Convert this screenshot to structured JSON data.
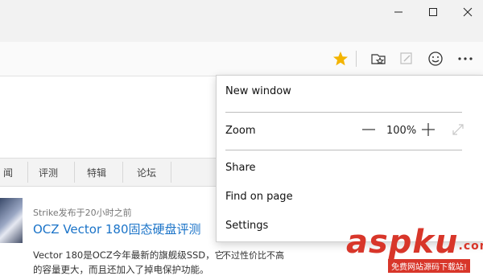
{
  "colors": {
    "accent": "#1a73c8",
    "favorite_star": "#f3b400",
    "watermark": "#d8362a"
  },
  "window": {
    "minimize_icon": "minimize-icon",
    "maximize_icon": "maximize-icon",
    "close_icon": "close-icon"
  },
  "toolbar": {
    "favorite_icon": "star-icon",
    "reading_list_icon": "hub-icon",
    "web_note_icon": "web-note-icon",
    "feedback_icon": "smiley-icon",
    "more_icon": "more-icon"
  },
  "site_nav": {
    "items": [
      "闻",
      "评测",
      "特辑",
      "论坛"
    ]
  },
  "article": {
    "meta": "Strike发布于20小时之前",
    "title": "OCZ Vector 180固态硬盘评测",
    "excerpt_line1": "Vector 180是OCZ今年最新的旗舰级SSD，它",
    "excerpt_line2": "的容量更大，而且还加入了掉电保护功能。"
  },
  "sidebar": {
    "partial_line": "…",
    "line": "不过性价比不高"
  },
  "menu": {
    "new_window": "New window",
    "zoom_label": "Zoom",
    "zoom_value": "100%",
    "zoom_out_icon": "minus-icon",
    "zoom_in_icon": "plus-icon",
    "fullscreen_icon": "fullscreen-icon",
    "share": "Share",
    "find_on_page": "Find on page",
    "settings": "Settings"
  },
  "watermark": {
    "main": "aspku",
    "suffix": ".com",
    "sub": "免费网站源码下载站!"
  }
}
